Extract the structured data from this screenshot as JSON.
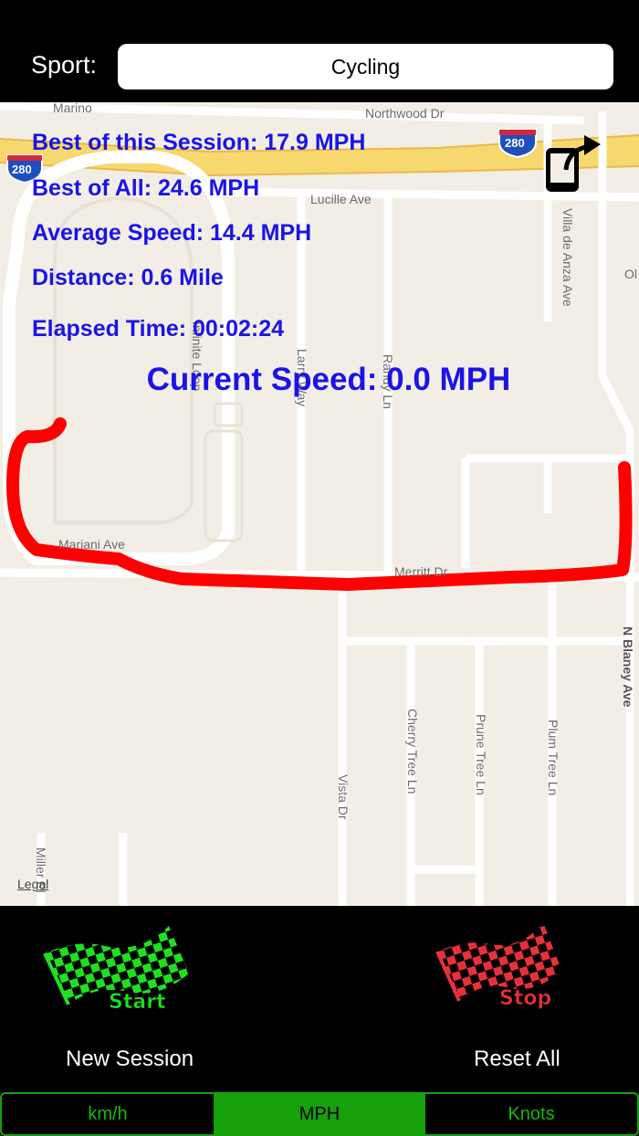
{
  "header": {
    "sport_label": "Sport:",
    "sport_value": "Cycling"
  },
  "stats": {
    "best_session": "Best of this Session: 17.9 MPH",
    "best_all": "Best of All: 24.6 MPH",
    "average_speed": "Average Speed: 14.4 MPH",
    "distance": "Distance: 0.6 Mile",
    "elapsed_time": "Elapsed Time: 00:02:24",
    "current_speed": "Current Speed: 0.0 MPH"
  },
  "map": {
    "legal": "Legal",
    "streets": {
      "northwood": "Northwood Dr",
      "lucille": "Lucille Ave",
      "villa": "Villa de Anza Ave",
      "marino": "Marino",
      "infinite": "Infinite Loop",
      "larry": "Larry Way",
      "randy": "Randy Ln",
      "mariani": "Mariani Ave",
      "merritt": "Merritt Dr",
      "blaney": "N Blaney Ave",
      "vista": "Vista Dr",
      "cherry": "Cherry Tree Ln",
      "prune": "Prune Tree Ln",
      "plum": "Plum Tree Ln",
      "miller": "Miller Pl",
      "ol": "Ol"
    },
    "shield_left": "280",
    "shield_right": "280",
    "route_color": "#ff0000"
  },
  "actions": {
    "start_flag_text": "Start",
    "stop_flag_text": "Stop",
    "new_session": "New Session",
    "reset_all": "Reset All"
  },
  "units": {
    "options": [
      "km/h",
      "MPH",
      "Knots"
    ],
    "selected": "MPH"
  },
  "colors": {
    "stat_text": "#1a14e6",
    "segment_accent": "#16a00a",
    "start_flag": "#1ee01e",
    "stop_flag": "#e8303a"
  }
}
